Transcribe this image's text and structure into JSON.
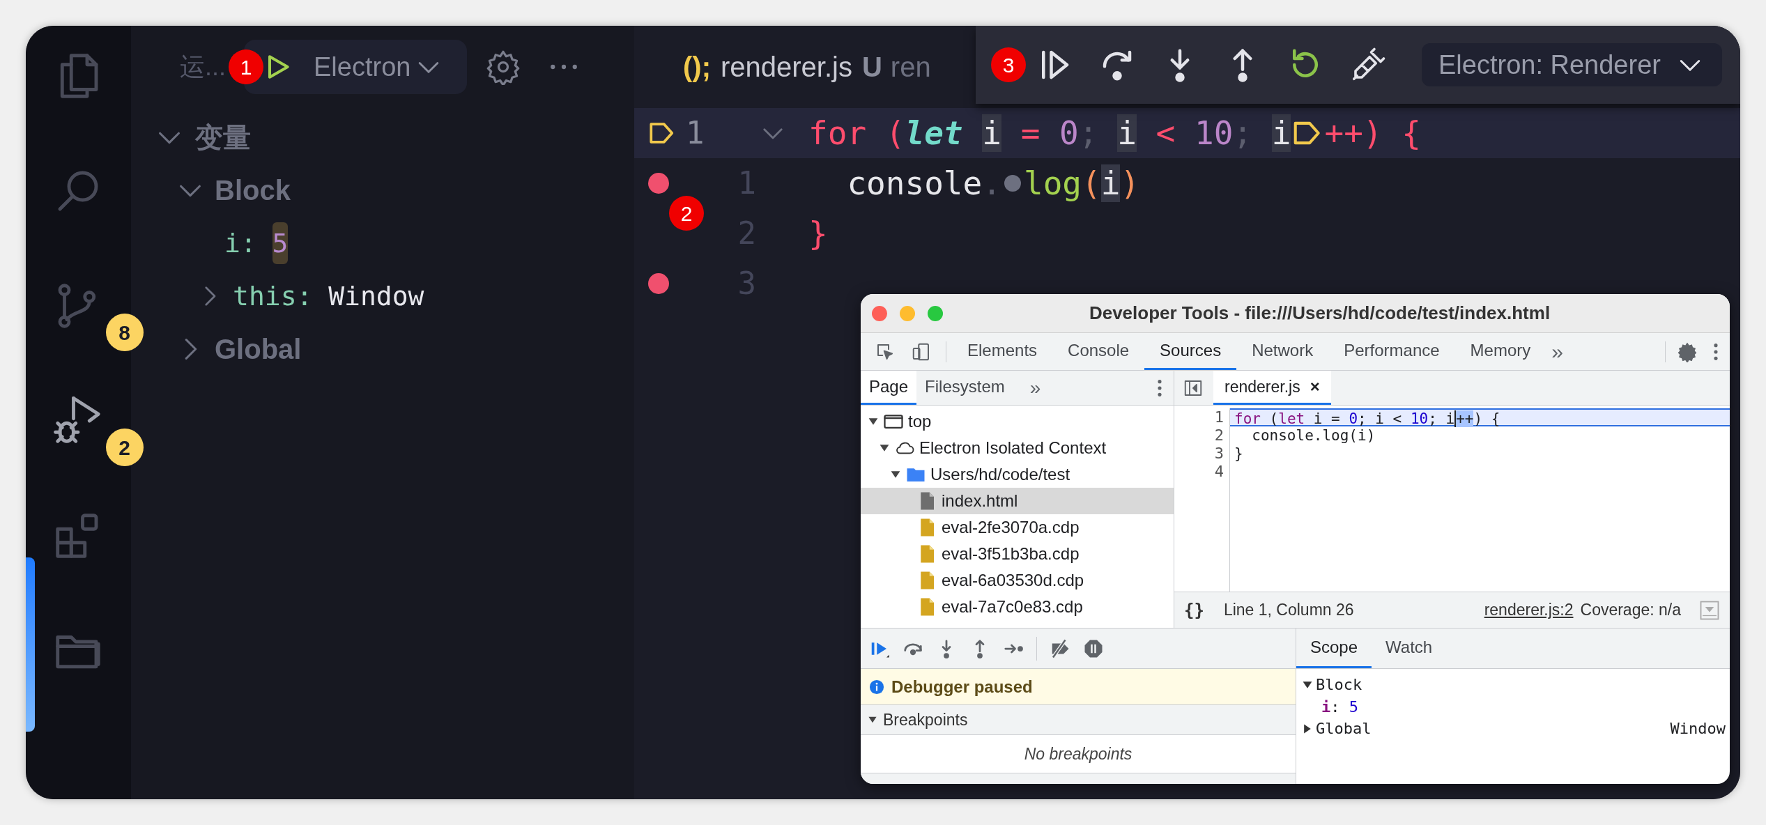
{
  "activity_bar": [
    {
      "kind": "explorer",
      "selected": false
    },
    {
      "kind": "search",
      "selected": false
    },
    {
      "kind": "source_control",
      "selected": false,
      "badge": "8"
    },
    {
      "kind": "run_debug",
      "selected": true,
      "badge": "2"
    },
    {
      "kind": "extensions",
      "selected": false
    },
    {
      "kind": "folders",
      "selected": false
    }
  ],
  "sidebar": {
    "title": "运...",
    "callout": "1",
    "run_config": "Electron",
    "section": {
      "title": "变量",
      "expanded": true,
      "scopes": [
        {
          "label": "Block",
          "expanded": true,
          "variables": [
            {
              "name": "i:",
              "value": "5",
              "changed": true
            },
            {
              "name": "this:",
              "value": "Window",
              "changed": false,
              "expanded": false
            }
          ]
        },
        {
          "label": "Global",
          "expanded": false
        }
      ]
    }
  },
  "editor": {
    "tabs": [
      {
        "file_icon": "();",
        "label": "renderer.js",
        "status": "U",
        "selected": true
      },
      {
        "label": "ren",
        "selected": false
      }
    ],
    "callout": "2",
    "sticky_line": {
      "number": "1",
      "paused": true,
      "tokens": [
        {
          "text": "for (",
          "kind": "keyword"
        },
        {
          "text": "let ",
          "kind": "storage"
        },
        {
          "text": "i",
          "kind": "hl_ident"
        },
        {
          "text": " = ",
          "kind": "op"
        },
        {
          "text": "0",
          "kind": "number"
        },
        {
          "text": "; ",
          "kind": "punct"
        },
        {
          "text": "i",
          "kind": "hl_ident"
        },
        {
          "text": " < ",
          "kind": "op"
        },
        {
          "text": "10",
          "kind": "number"
        },
        {
          "text": "; ",
          "kind": "punct"
        },
        {
          "text": "i",
          "kind": "hl_ident"
        },
        {
          "kind": "pause_marker"
        },
        {
          "text": "++) {",
          "kind": "op"
        }
      ]
    },
    "lines": [
      {
        "number": "1",
        "breakpoint": true,
        "tokens": [
          {
            "text": "  console",
            "kind": "ident"
          },
          {
            "text": ".",
            "kind": "punct"
          },
          {
            "kind": "inline_breakpoint"
          },
          {
            "text": "log",
            "kind": "func"
          },
          {
            "text": "(",
            "kind": "paren"
          },
          {
            "text": "i",
            "kind": "hl_ident"
          },
          {
            "text": ")",
            "kind": "paren"
          }
        ]
      },
      {
        "number": "2",
        "breakpoint": false,
        "tokens": [
          {
            "text": "}",
            "kind": "brace"
          }
        ]
      },
      {
        "number": "3",
        "breakpoint": true
      }
    ]
  },
  "debug_toolbar": {
    "callout": "3",
    "buttons": [
      {
        "kind": "continue"
      },
      {
        "kind": "step_over"
      },
      {
        "kind": "step_into"
      },
      {
        "kind": "step_out"
      },
      {
        "kind": "restart"
      },
      {
        "kind": "disconnect"
      }
    ],
    "config": "Electron: Renderer"
  },
  "devtools": {
    "title": "Developer Tools - file:///Users/hd/code/test/index.html",
    "tabs": [
      {
        "label": "Elements",
        "selected": false
      },
      {
        "label": "Console",
        "selected": false
      },
      {
        "label": "Sources",
        "selected": true
      },
      {
        "label": "Network",
        "selected": false
      },
      {
        "label": "Performance",
        "selected": false
      },
      {
        "label": "Memory",
        "selected": false
      }
    ],
    "more": "»",
    "navigator": {
      "tabs": [
        {
          "label": "Page",
          "selected": true
        },
        {
          "label": "Filesystem",
          "selected": false
        }
      ],
      "more": "»",
      "tree": [
        {
          "kind": "frame",
          "label": "top",
          "selected": false,
          "expanded": true,
          "children": [
            {
              "kind": "context",
              "label": "Electron Isolated Context",
              "selected": false,
              "expanded": true,
              "children": [
                {
                  "kind": "folder",
                  "label": "Users/hd/code/test",
                  "selected": false,
                  "expanded": true,
                  "children": [
                    {
                      "kind": "html",
                      "label": "index.html",
                      "selected": true
                    },
                    {
                      "kind": "script",
                      "label": "eval-2fe3070a.cdp",
                      "selected": false
                    },
                    {
                      "kind": "script",
                      "label": "eval-3f51b3ba.cdp",
                      "selected": false
                    },
                    {
                      "kind": "script",
                      "label": "eval-6a03530d.cdp",
                      "selected": false
                    },
                    {
                      "kind": "script",
                      "label": "eval-7a7c0e83.cdp",
                      "selected": false
                    }
                  ]
                }
              ]
            }
          ]
        }
      ]
    },
    "source": {
      "tab": "renderer.js",
      "close": "×",
      "lines": [
        {
          "number": "1",
          "current": true,
          "tokens": [
            {
              "text": "for",
              "kind": "keyword"
            },
            {
              "text": " (",
              "kind": "plain"
            },
            {
              "text": "let",
              "kind": "keyword"
            },
            {
              "text": " i = ",
              "kind": "plain"
            },
            {
              "text": "0",
              "kind": "number"
            },
            {
              "text": "; i < ",
              "kind": "plain"
            },
            {
              "text": "10",
              "kind": "number"
            },
            {
              "text": "; i",
              "kind": "plain"
            },
            {
              "text": "++",
              "kind": "selection"
            },
            {
              "text": ") {",
              "kind": "plain"
            }
          ]
        },
        {
          "number": "2",
          "current": false,
          "tokens": [
            {
              "text": "  console.log(i)",
              "kind": "plain"
            }
          ]
        },
        {
          "number": "3",
          "current": false,
          "tokens": [
            {
              "text": "}",
              "kind": "plain"
            }
          ]
        },
        {
          "number": "4",
          "current": false
        }
      ],
      "status": {
        "format": "{}",
        "position": "Line 1, Column 26",
        "link": "renderer.js:2",
        "coverage": "Coverage: n/a"
      }
    },
    "debugger": {
      "buttons": [
        {
          "kind": "resume",
          "active": true
        },
        {
          "kind": "step_over",
          "active": false
        },
        {
          "kind": "step_into",
          "active": false
        },
        {
          "kind": "step_out",
          "active": false
        },
        {
          "kind": "step",
          "active": false
        },
        {
          "kind": "deactivate_breakpoints",
          "active": false
        },
        {
          "kind": "pause_on_exceptions",
          "active": false
        }
      ],
      "banner": "Debugger paused",
      "sections": [
        {
          "title": "Breakpoints",
          "expanded": true,
          "empty_text": "No breakpoints"
        }
      ]
    },
    "scope": {
      "tabs": [
        {
          "label": "Scope",
          "selected": true
        },
        {
          "label": "Watch",
          "selected": false
        }
      ],
      "tree": [
        {
          "label": "Block",
          "expanded": true,
          "variables": [
            {
              "name": "i",
              "separator": ":",
              "value": "5"
            }
          ]
        },
        {
          "label": "Global",
          "expanded": false,
          "value": "Window"
        }
      ]
    }
  }
}
